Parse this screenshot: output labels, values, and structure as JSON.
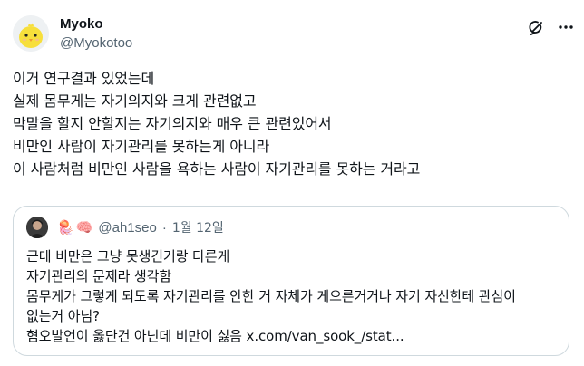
{
  "author": {
    "display_name": "Myoko",
    "handle": "@Myokotoo"
  },
  "tweet": {
    "lines": [
      "이거 연구결과 있었는데",
      "실제 몸무게는 자기의지와 크게 관련없고",
      "막말을 할지 안할지는 자기의지와 매우 큰 관련있어서",
      "비만인 사람이 자기관리를 못하는게 아니라",
      "이 사람처럼 비만인 사람을 욕하는 사람이 자기관리를 못하는 거라고"
    ]
  },
  "quote": {
    "emojis": [
      "🪼",
      "🧠"
    ],
    "handle": "@ah1seo",
    "separator": "·",
    "date": "1월 12일",
    "lines": [
      "근데 비만은 그냥 못생긴거랑 다른게",
      "자기관리의 문제라 생각함",
      "몸무게가 그렇게 되도록 자기관리를 안한 거 자체가 게으른거거나 자기 자신한테 관심이",
      "없는거 아님?",
      "혐오발언이 옳단건 아닌데 비만이 싫음 x.com/van_sook_/stat..."
    ]
  },
  "icons": {
    "grok": "grok-icon",
    "more": "more-icon"
  }
}
